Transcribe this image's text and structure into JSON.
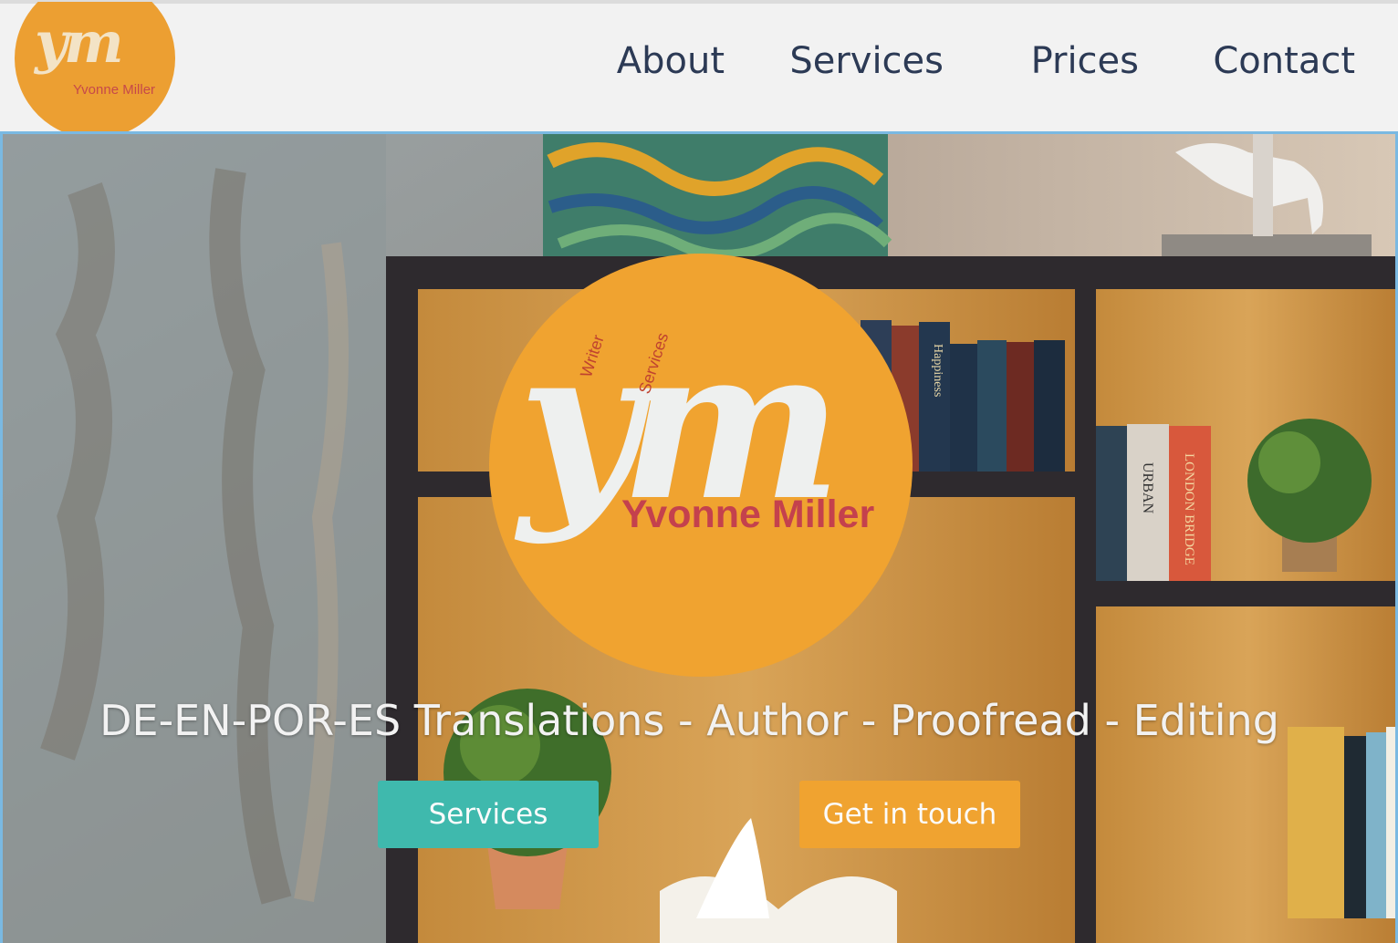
{
  "brand": {
    "monogram": "ym",
    "name": "Yvonne Miller",
    "tag_writer": "Writer",
    "tag_services": "Services"
  },
  "nav": {
    "items": [
      {
        "label": "About"
      },
      {
        "label": "Services"
      },
      {
        "label": "Prices"
      },
      {
        "label": "Contact"
      }
    ]
  },
  "hero": {
    "tagline": "DE-EN-POR-ES Translations - Author - Proofread - Editing",
    "primary_button": "Services",
    "secondary_button": "Get in touch",
    "book_spines": [
      "Happiness",
      "URBAN",
      "LONDON BRIDGE"
    ]
  },
  "colors": {
    "accent_orange": "#f0a330",
    "accent_teal": "#3fb9ad",
    "brand_red": "#c4414d",
    "nav_text": "#2c3a55",
    "frame_border": "#7ab9e2"
  }
}
